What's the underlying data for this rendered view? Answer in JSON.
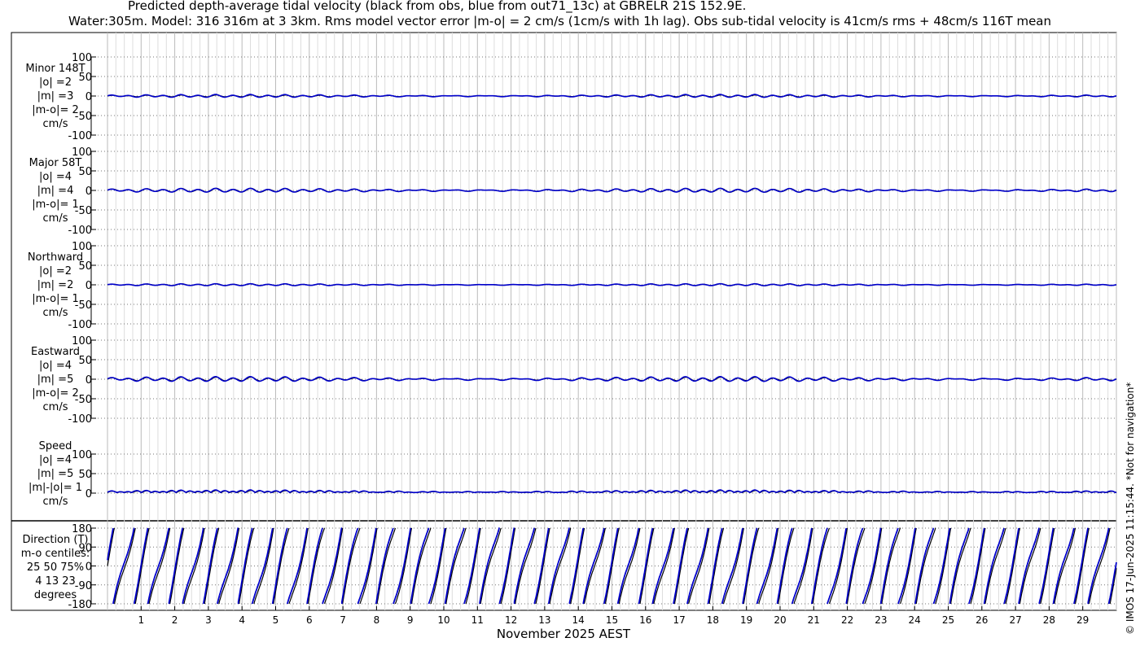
{
  "title_line1": "Predicted depth-average tidal velocity (black from obs, blue from out71_13c) at GBRELR 21S 152.9E.",
  "title_line2": "Water:305m. Model: 316 316m at 3 3km. Rms model vector error |m-o| = 2 cm/s (1cm/s with 1h lag). Obs sub-tidal velocity is 41cm/s rms + 48cm/s 116T mean",
  "watermark": "© IMOS 17-Jun-2025 11:15:44. *Not for navigation*",
  "colors": {
    "obs": "#000000",
    "model": "#0000cc",
    "grid": "#999999"
  },
  "chart_data": [
    {
      "type": "line",
      "name": "minor",
      "label_lines": [
        "Minor 148T",
        "|o| =2",
        "|m| =3",
        "|m-o|= 2",
        "cm/s"
      ],
      "ylim": [
        -100,
        100
      ],
      "yticks": [
        "100",
        "50",
        "0",
        "-50",
        "-100"
      ],
      "amp_obs": 2,
      "amp_model": 3,
      "series": [
        {
          "values_summary": "obs",
          "amplitude": 2
        },
        {
          "values_summary": "model",
          "amplitude": 3
        }
      ]
    },
    {
      "type": "line",
      "name": "major",
      "label_lines": [
        "Major 58T",
        "|o| =4",
        "|m| =4",
        "|m-o|= 1",
        "cm/s"
      ],
      "ylim": [
        -100,
        100
      ],
      "yticks": [
        "100",
        "50",
        "0",
        "-50",
        "-100"
      ],
      "amp_obs": 4,
      "amp_model": 4,
      "series": [
        {
          "values_summary": "obs",
          "amplitude": 4
        },
        {
          "values_summary": "model",
          "amplitude": 4
        }
      ]
    },
    {
      "type": "line",
      "name": "northward",
      "label_lines": [
        "Northward",
        "|o| =2",
        "|m| =2",
        "|m-o|= 1",
        "cm/s"
      ],
      "ylim": [
        -100,
        100
      ],
      "yticks": [
        "100",
        "50",
        "0",
        "-50",
        "-100"
      ],
      "amp_obs": 2,
      "amp_model": 2,
      "series": [
        {
          "values_summary": "obs",
          "amplitude": 2
        },
        {
          "values_summary": "model",
          "amplitude": 2
        }
      ]
    },
    {
      "type": "line",
      "name": "eastward",
      "label_lines": [
        "Eastward",
        "|o| =4",
        "|m| =5",
        "|m-o|= 2",
        "cm/s"
      ],
      "ylim": [
        -100,
        100
      ],
      "yticks": [
        "100",
        "50",
        "0",
        "-50",
        "-100"
      ],
      "amp_obs": 4,
      "amp_model": 5,
      "series": [
        {
          "values_summary": "obs",
          "amplitude": 4
        },
        {
          "values_summary": "model",
          "amplitude": 5
        }
      ]
    },
    {
      "type": "line",
      "name": "speed",
      "label_lines": [
        "Speed",
        "|o| =4",
        "|m| =5",
        "|m|-|o|= 1",
        "cm/s"
      ],
      "ylim": [
        0,
        100
      ],
      "yticks": [
        "100",
        "50",
        "0"
      ],
      "amp_obs": 4,
      "amp_model": 5,
      "series": [
        {
          "values_summary": "obs",
          "amplitude": 4
        },
        {
          "values_summary": "model",
          "amplitude": 5
        }
      ]
    },
    {
      "type": "line",
      "name": "direction",
      "label_lines": [
        "Direction (T)",
        "m-o centiles:",
        "25  50  75%",
        "4  13  23",
        "degrees"
      ],
      "ylim": [
        -180,
        180
      ],
      "yticks": [
        "180",
        "90",
        "0",
        "-90",
        "-180"
      ],
      "series": [
        {
          "values_summary": "obs"
        },
        {
          "values_summary": "model"
        }
      ]
    }
  ],
  "x_axis": {
    "label": "November 2025 AEST",
    "ticks": [
      "1",
      "2",
      "3",
      "4",
      "5",
      "6",
      "7",
      "8",
      "9",
      "10",
      "11",
      "12",
      "13",
      "14",
      "15",
      "16",
      "17",
      "18",
      "19",
      "20",
      "21",
      "22",
      "23",
      "24",
      "25",
      "26",
      "27",
      "28",
      "29"
    ],
    "range_days": [
      0,
      30
    ]
  }
}
